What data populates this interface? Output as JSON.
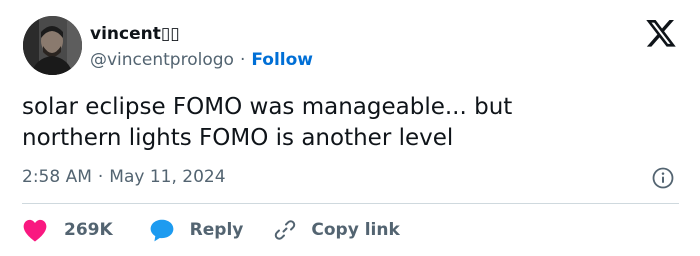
{
  "author": {
    "display_name": "vincent▯▯",
    "handle": "@vincentprologo",
    "separator": "·",
    "follow_label": "Follow"
  },
  "tweet": {
    "text": "solar eclipse FOMO was manageable... but\nnorthern lights FOMO is another level",
    "time": "2:58 AM",
    "separator": "·",
    "date": "May 11, 2024"
  },
  "actions": {
    "like_count": "269K",
    "reply_label": "Reply",
    "copy_link_label": "Copy link"
  },
  "icons": {
    "logo": "x-logo-icon",
    "info": "info-icon",
    "like": "heart-icon",
    "reply": "speech-bubble-icon",
    "copy": "link-icon"
  },
  "colors": {
    "text": "#0f1419",
    "secondary": "#536471",
    "follow": "#006fd6",
    "heart": "#f91880",
    "reply_bubble": "#1d9bf0",
    "divider": "#cfd9de"
  }
}
